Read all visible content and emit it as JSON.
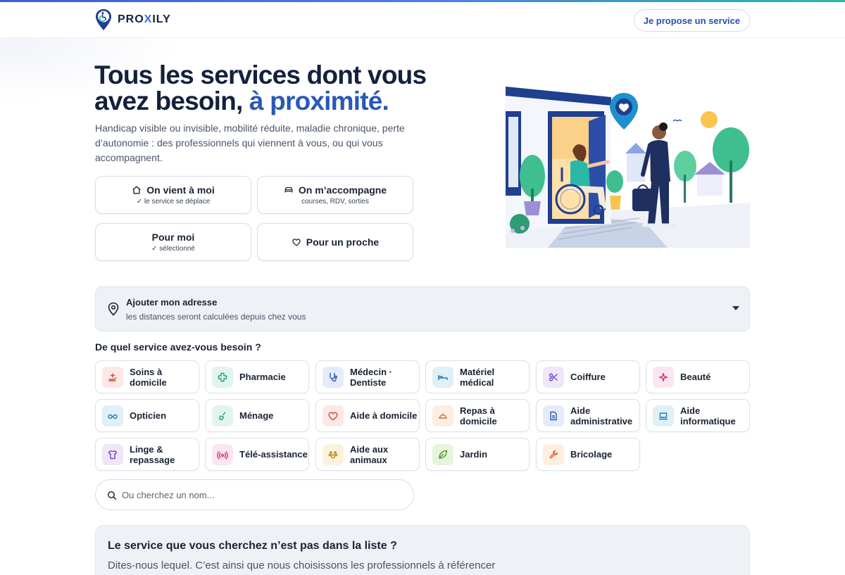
{
  "brand": {
    "name_prefix": "PRO",
    "name_accent": "X",
    "name_suffix": "ILY"
  },
  "header": {
    "propose_label": "Je propose un service"
  },
  "hero": {
    "title_line1": "Tous les services dont vous",
    "title_line2_plain": "avez besoin, ",
    "title_line2_accent": "à proximité.",
    "subtitle": "Handicap visible ou invisible, mobilité réduite, maladie chronique, perte d’autonomie : des professionnels qui viennent à vous, ou qui vous accompagnent."
  },
  "choices": [
    {
      "label": "On vient à moi",
      "sub": "✓ le service se déplace",
      "icon": "home-icon"
    },
    {
      "label": "On m’accompagne",
      "sub": "courses, RDV, sorties",
      "icon": "car-icon"
    },
    {
      "label": "Pour moi",
      "sub": "✓ sélectionné",
      "icon": ""
    },
    {
      "label": "Pour un proche",
      "sub": "",
      "icon": "heart-icon"
    }
  ],
  "address": {
    "title": "Ajouter mon adresse",
    "subtitle": "les distances seront calculées depuis chez vous"
  },
  "services_title": "De quel service avez-vous besoin ?",
  "services": [
    {
      "label": "Soins à domicile",
      "icon": "care-hand-icon",
      "color": "#fde8e6"
    },
    {
      "label": "Pharmacie",
      "icon": "cross-icon",
      "color": "#e1f4ee"
    },
    {
      "label": "Médecin · Dentiste",
      "icon": "stethoscope-icon",
      "color": "#e4ebfb"
    },
    {
      "label": "Matériel médical",
      "icon": "bed-icon",
      "color": "#e0f0f7"
    },
    {
      "label": "Coiffure",
      "icon": "scissors-icon",
      "color": "#efe6fa"
    },
    {
      "label": "Beauté",
      "icon": "sparkle-icon",
      "color": "#fbe6ef"
    },
    {
      "label": "Opticien",
      "icon": "glasses-icon",
      "color": "#e0f0f7"
    },
    {
      "label": "Ménage",
      "icon": "broom-icon",
      "color": "#e1f4ee"
    },
    {
      "label": "Aide à domicile",
      "icon": "heart-icon",
      "color": "#fde8e6"
    },
    {
      "label": "Repas à domicile",
      "icon": "cloche-icon",
      "color": "#fdeee2"
    },
    {
      "label": "Aide administrative",
      "icon": "document-icon",
      "color": "#e4ebfb"
    },
    {
      "label": "Aide informatique",
      "icon": "laptop-icon",
      "color": "#e0f0f7"
    },
    {
      "label": "Linge & repassage",
      "icon": "shirt-icon",
      "color": "#efe6fa"
    },
    {
      "label": "Télé-assistance",
      "icon": "signal-icon",
      "color": "#fbe6ef"
    },
    {
      "label": "Aide aux animaux",
      "icon": "paw-icon",
      "color": "#fbf2dc"
    },
    {
      "label": "Jardin",
      "icon": "leaf-icon",
      "color": "#e6f4dd"
    },
    {
      "label": "Bricolage",
      "icon": "wrench-icon",
      "color": "#fdeee2"
    }
  ],
  "search": {
    "placeholder": "Ou cherchez un nom..."
  },
  "missing": {
    "title": "Le service que vous cherchez n’est pas dans la liste ?",
    "text": "Dites-nous lequel. C’est ainsi que nous choisissons les professionnels à référencer"
  },
  "colors": {
    "brand_blue": "#2a58b8",
    "navy": "#14213d",
    "teal": "#2bb8a6"
  }
}
